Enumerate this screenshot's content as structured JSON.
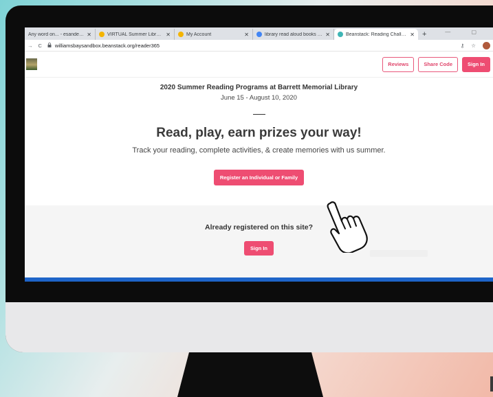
{
  "browser": {
    "tabs": [
      {
        "title": "Any word on... - esanders@wi",
        "favicon_color": "#9aa0a6",
        "active": false
      },
      {
        "title": "VIRTUAL Summer Library Prog",
        "favicon_color": "#f4b400",
        "active": false
      },
      {
        "title": "My Account",
        "favicon_color": "#f4b400",
        "active": false
      },
      {
        "title": "library read aloud books for te",
        "favicon_color": "#4285f4",
        "active": false
      },
      {
        "title": "Beanstack: Reading Challenge",
        "favicon_color": "#3fb5b5",
        "active": true
      }
    ],
    "new_tab_label": "+",
    "window_controls": "— ▢",
    "url": "williamsbaysandbox.beanstack.org/reader365",
    "back_icon": "→",
    "reload_icon": "C",
    "lock_icon": "🔒",
    "key_icon": "⚷",
    "star_icon": "☆"
  },
  "site": {
    "header": {
      "reviews_label": "Reviews",
      "share_code_label": "Share Code",
      "sign_in_label": "Sign In"
    },
    "hero": {
      "program_title": "2020 Summer Reading Programs at Barrett Memorial Library",
      "program_dates": "June 15 - August 10, 2020",
      "headline": "Read, play, earn prizes your way!",
      "tagline": "Track your reading, complete activities, & create memories with us summer.",
      "register_label": "Register an Individual or Family"
    },
    "signin_band": {
      "prompt": "Already registered on this site?",
      "sign_in_label": "Sign In"
    }
  },
  "colors": {
    "accent": "#ee4d72",
    "blue_bar": "#1e64c8"
  }
}
